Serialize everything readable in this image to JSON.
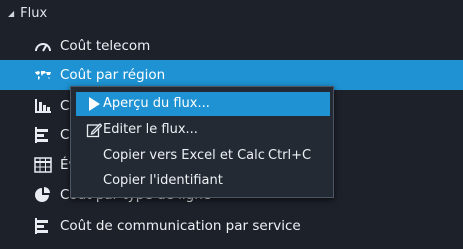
{
  "tree": {
    "section_label": "Flux",
    "items": [
      {
        "icon": "gauge-icon",
        "label": "Coût telecom"
      },
      {
        "icon": "world-map-icon",
        "label": "Coût par région"
      },
      {
        "icon": "bar-chart-icon",
        "label": "Co"
      },
      {
        "icon": "horizontal-bar-chart-icon",
        "label": "Co"
      },
      {
        "icon": "table-grid-icon",
        "label": "Év"
      },
      {
        "icon": "pie-chart-icon",
        "label": "Coût par type de ligne"
      },
      {
        "icon": "horizontal-bar-chart-icon",
        "label": "Coût de communication par service"
      }
    ]
  },
  "context_menu": {
    "items": [
      {
        "label": "Aperçu du flux...",
        "icon": "play-icon",
        "shortcut": ""
      },
      {
        "label": "Editer le flux...",
        "icon": "edit-pencil-icon",
        "shortcut": ""
      },
      {
        "label": "Copier vers Excel et Calc",
        "icon": "",
        "shortcut": "Ctrl+C"
      },
      {
        "label": "Copier l'identifiant",
        "icon": "",
        "shortcut": ""
      }
    ]
  },
  "colors": {
    "background": "#1d2129",
    "selection": "#1e92d2",
    "menu_background": "#232a33",
    "menu_border": "#4b5563"
  }
}
